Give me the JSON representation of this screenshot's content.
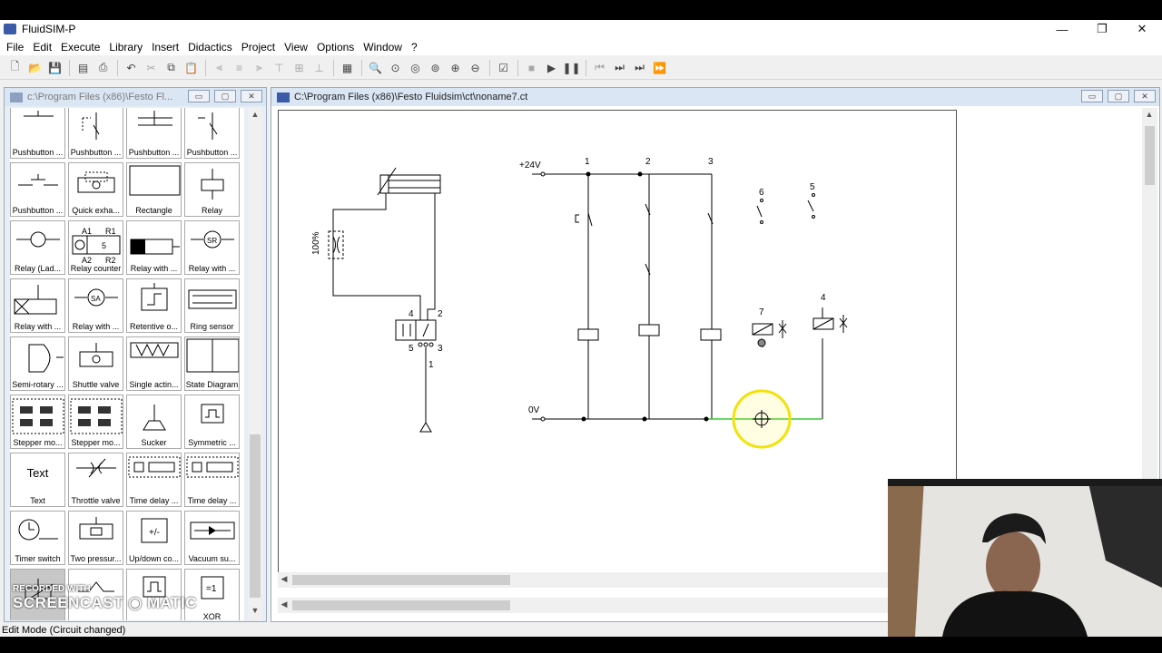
{
  "app": {
    "title": "FluidSIM-P"
  },
  "window_controls": {
    "minimize": "—",
    "maximize": "❐",
    "close": "✕"
  },
  "menu": [
    "File",
    "Edit",
    "Execute",
    "Library",
    "Insert",
    "Didactics",
    "Project",
    "View",
    "Options",
    "Window",
    "?"
  ],
  "toolbar": {
    "icons": [
      "new-file-icon",
      "open-folder-icon",
      "save-icon",
      "print-preview-icon",
      "print-icon",
      "undo-icon",
      "cut-icon",
      "copy-icon",
      "paste-icon",
      "align-left-icon",
      "align-center-icon",
      "align-right-icon",
      "align-top-icon",
      "align-middle-icon",
      "align-bottom-icon",
      "grid-icon",
      "zoom-fit-icon",
      "zoom-previous-icon",
      "zoom-window-icon",
      "zoom-page-icon",
      "zoom-in-icon",
      "zoom-out-icon",
      "check-drawing-icon",
      "stop-icon",
      "play-icon",
      "pause-icon",
      "reset-icon",
      "step-mode-icon",
      "step-icon",
      "run-until-icon"
    ]
  },
  "library_window": {
    "title": "c:\\Program Files (x86)\\Festo Fl...",
    "items": [
      "Pushbutton ...",
      "Pushbutton ...",
      "Pushbutton ...",
      "Pushbutton ...",
      "Pushbutton ...",
      "Quick exha...",
      "Rectangle",
      "Relay",
      "Relay (Lad...",
      "Relay counter",
      "Relay with ...",
      "Relay with ...",
      "Relay with ...",
      "Relay with ...",
      "Retentive o...",
      "Ring sensor",
      "Semi-rotary ...",
      "Shuttle valve",
      "Single actin...",
      "State Diagram",
      "Stepper mo...",
      "Stepper mo...",
      "Sucker",
      "Symmetric ...",
      "Text",
      "Throttle valve",
      "Time delay ...",
      "Time delay ...",
      "Timer switch",
      "Two pressur...",
      "Up/down co...",
      "Vacuum su...",
      "",
      "",
      "",
      "XOR"
    ],
    "text_item_glyph": "Text",
    "relay_counter_glyph": {
      "a1": "A1",
      "r1": "R1",
      "a2": "A2",
      "r2": "R2",
      "five": "5"
    },
    "relay_sa": "SA",
    "relay_sr": "SR"
  },
  "circuit_window": {
    "title": "C:\\Program Files (x86)\\Festo Fluidsim\\ct\\noname7.ct",
    "labels": {
      "supply": "+24V",
      "ground": "0V",
      "pct": "100%",
      "c1": "1",
      "c2": "2",
      "c3": "3",
      "c4": "4",
      "c5": "5",
      "c6": "6",
      "c7": "7",
      "p4": "4",
      "p2": "2",
      "p5": "5",
      "p3": "3",
      "p1": "1"
    }
  },
  "status": {
    "text": "Edit Mode (Circuit changed)"
  },
  "watermark": {
    "line1": "RECORDED WITH",
    "line2": "SCREENCAST",
    "line3": "MATIC"
  },
  "colors": {
    "wire": "#000000",
    "selected_wire": "#33cc33",
    "highlight": "#f2e20a"
  }
}
